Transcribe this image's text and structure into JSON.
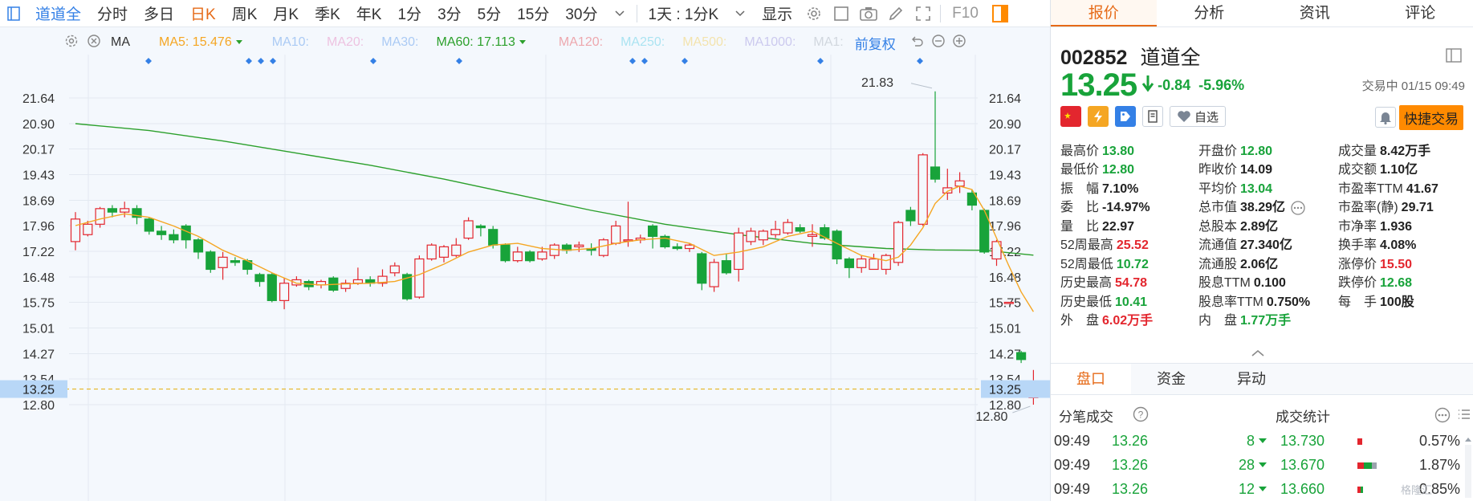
{
  "toolbar": {
    "items": [
      "道道全",
      "分时",
      "多日",
      "日K",
      "周K",
      "月K",
      "季K",
      "年K",
      "1分",
      "3分",
      "5分",
      "15分",
      "30分"
    ],
    "period_select": "1天 : 1分K",
    "display_label": "显示",
    "f10_label": "F10"
  },
  "ma_row": {
    "ma_label": "MA",
    "ma5": "MA5: 15.476",
    "ma10": "MA10:",
    "ma20": "MA20:",
    "ma30": "MA30:",
    "ma60": "MA60: 17.113",
    "ma120": "MA120:",
    "ma250": "MA250:",
    "ma500": "MA500:",
    "ma1000": "MA1000:",
    "ma1": "MA1:",
    "adjust_label": "前复权",
    "colors": {
      "ma5": "#f5a623",
      "ma10": "#3480e6",
      "ma20": "#e46bb3",
      "ma30": "#3480e6",
      "ma60": "#2ca02c",
      "ma120": "#e3262e",
      "ma250": "#35c3e0",
      "ma500": "#f2c32e",
      "ma1000": "#8b7fd8",
      "ma1": "#9aa3ad"
    }
  },
  "chart_data": {
    "type": "candlestick",
    "y_ticks": [
      "21.64",
      "20.90",
      "20.17",
      "19.43",
      "18.69",
      "17.96",
      "17.22",
      "16.48",
      "15.75",
      "15.01",
      "14.27",
      "13.54",
      "12.80"
    ],
    "ylim": [
      12.8,
      21.64
    ],
    "current_price": "13.25",
    "high_label": "21.83",
    "low_label": "12.80",
    "colors": {
      "up": "#e3262e",
      "down": "#18a33a",
      "ma5": "#f5a623",
      "ma60": "#2ca02c"
    },
    "candles": [
      [
        17.5,
        18.15,
        18.35,
        17.25
      ],
      [
        17.7,
        18.0,
        18.1,
        17.65
      ],
      [
        18.0,
        18.45,
        18.5,
        17.9
      ],
      [
        18.45,
        18.35,
        18.55,
        18.2
      ],
      [
        18.35,
        18.45,
        18.65,
        18.2
      ],
      [
        18.45,
        18.2,
        18.55,
        18.0
      ],
      [
        18.15,
        17.8,
        18.2,
        17.7
      ],
      [
        17.8,
        17.7,
        17.95,
        17.55
      ],
      [
        17.7,
        17.55,
        17.85,
        17.45
      ],
      [
        17.95,
        17.55,
        18.0,
        17.3
      ],
      [
        17.55,
        17.2,
        17.6,
        17.0
      ],
      [
        17.2,
        16.7,
        17.25,
        16.6
      ],
      [
        16.75,
        17.05,
        17.2,
        16.4
      ],
      [
        16.95,
        16.9,
        17.05,
        16.8
      ],
      [
        16.95,
        16.7,
        17.0,
        16.55
      ],
      [
        16.55,
        16.35,
        16.6,
        16.2
      ],
      [
        16.55,
        15.8,
        16.6,
        15.75
      ],
      [
        15.8,
        16.3,
        16.45,
        15.55
      ],
      [
        16.25,
        16.4,
        16.5,
        16.2
      ],
      [
        16.35,
        16.2,
        16.4,
        16.1
      ],
      [
        16.25,
        16.35,
        16.4,
        16.15
      ],
      [
        16.45,
        16.1,
        16.5,
        16.05
      ],
      [
        16.15,
        16.3,
        16.4,
        16.05
      ],
      [
        16.3,
        16.4,
        16.75,
        16.25
      ],
      [
        16.4,
        16.3,
        16.5,
        16.2
      ],
      [
        16.3,
        16.5,
        16.7,
        16.2
      ],
      [
        16.6,
        16.8,
        16.9,
        16.5
      ],
      [
        16.55,
        15.85,
        16.6,
        15.8
      ],
      [
        15.9,
        17.0,
        17.1,
        15.85
      ],
      [
        17.0,
        17.4,
        17.45,
        16.95
      ],
      [
        17.05,
        17.35,
        17.4,
        16.9
      ],
      [
        17.1,
        17.4,
        17.6,
        17.05
      ],
      [
        17.6,
        18.1,
        18.2,
        17.55
      ],
      [
        17.95,
        17.9,
        18.0,
        17.65
      ],
      [
        17.85,
        17.4,
        17.95,
        17.3
      ],
      [
        17.4,
        16.95,
        17.45,
        16.9
      ],
      [
        16.95,
        17.2,
        17.35,
        16.9
      ],
      [
        17.2,
        16.95,
        17.25,
        16.9
      ],
      [
        17.0,
        17.2,
        17.35,
        16.95
      ],
      [
        17.1,
        17.4,
        17.45,
        17.0
      ],
      [
        17.4,
        17.25,
        17.45,
        17.15
      ],
      [
        17.35,
        17.4,
        17.5,
        17.2
      ],
      [
        17.3,
        17.25,
        17.45,
        17.1
      ],
      [
        17.1,
        17.55,
        17.6,
        17.05
      ],
      [
        17.45,
        17.95,
        18.1,
        17.4
      ],
      [
        17.55,
        17.55,
        18.65,
        17.35
      ],
      [
        17.55,
        17.6,
        17.7,
        17.45
      ],
      [
        17.95,
        17.65,
        18.0,
        17.3
      ],
      [
        17.65,
        17.35,
        17.7,
        17.3
      ],
      [
        17.35,
        17.3,
        17.45,
        17.25
      ],
      [
        17.3,
        17.4,
        17.45,
        17.2
      ],
      [
        17.15,
        16.3,
        17.2,
        16.1
      ],
      [
        16.2,
        16.9,
        17.0,
        16.05
      ],
      [
        16.95,
        16.6,
        17.15,
        16.55
      ],
      [
        16.7,
        17.75,
        17.9,
        16.35
      ],
      [
        17.5,
        17.8,
        17.9,
        17.4
      ],
      [
        17.55,
        17.8,
        17.85,
        17.4
      ],
      [
        17.7,
        17.85,
        18.1,
        17.6
      ],
      [
        17.75,
        18.05,
        18.15,
        17.7
      ],
      [
        17.9,
        17.8,
        18.0,
        17.75
      ],
      [
        17.65,
        17.7,
        18.0,
        17.35
      ],
      [
        17.9,
        17.6,
        18.0,
        17.55
      ],
      [
        17.8,
        17.0,
        17.85,
        16.85
      ],
      [
        17.0,
        16.75,
        17.05,
        16.45
      ],
      [
        16.75,
        17.0,
        17.1,
        16.6
      ],
      [
        16.7,
        17.0,
        17.15,
        16.7
      ],
      [
        16.7,
        17.1,
        17.15,
        16.55
      ],
      [
        16.9,
        18.05,
        18.1,
        16.8
      ],
      [
        18.4,
        18.1,
        18.5,
        17.95
      ],
      [
        18.0,
        20.0,
        20.05,
        17.95
      ],
      [
        19.65,
        19.3,
        21.83,
        19.2
      ],
      [
        18.9,
        19.05,
        19.6,
        18.7
      ],
      [
        19.1,
        19.25,
        19.5,
        18.9
      ],
      [
        18.9,
        18.55,
        19.0,
        18.4
      ],
      [
        18.4,
        17.2,
        18.45,
        17.15
      ],
      [
        17.0,
        17.5,
        17.55,
        16.8
      ],
      [
        15.75,
        15.75,
        15.75,
        15.75
      ],
      [
        14.3,
        14.1,
        14.35,
        14.0
      ],
      [
        13.0,
        13.25,
        13.8,
        12.8
      ]
    ],
    "ma5": [
      [
        0,
        17.96
      ],
      [
        2,
        18.15
      ],
      [
        4,
        18.3
      ],
      [
        6,
        18.2
      ],
      [
        8,
        17.95
      ],
      [
        10,
        17.65
      ],
      [
        12,
        17.25
      ],
      [
        14,
        16.95
      ],
      [
        16,
        16.6
      ],
      [
        18,
        16.3
      ],
      [
        20,
        16.25
      ],
      [
        22,
        16.28
      ],
      [
        24,
        16.3
      ],
      [
        26,
        16.35
      ],
      [
        28,
        16.55
      ],
      [
        30,
        16.85
      ],
      [
        32,
        17.2
      ],
      [
        34,
        17.4
      ],
      [
        36,
        17.45
      ],
      [
        38,
        17.3
      ],
      [
        40,
        17.25
      ],
      [
        42,
        17.3
      ],
      [
        44,
        17.45
      ],
      [
        46,
        17.55
      ],
      [
        48,
        17.6
      ],
      [
        50,
        17.45
      ],
      [
        52,
        17.1
      ],
      [
        54,
        17.2
      ],
      [
        56,
        17.35
      ],
      [
        58,
        17.65
      ],
      [
        60,
        17.8
      ],
      [
        62,
        17.45
      ],
      [
        64,
        17.1
      ],
      [
        66,
        16.95
      ],
      [
        67,
        17.05
      ],
      [
        68,
        17.4
      ],
      [
        69,
        17.9
      ],
      [
        70,
        18.6
      ],
      [
        71,
        18.95
      ],
      [
        72,
        19.1
      ],
      [
        73,
        19.0
      ],
      [
        74,
        18.4
      ],
      [
        75,
        17.6
      ],
      [
        76,
        16.8
      ],
      [
        77,
        16.05
      ],
      [
        78,
        15.48
      ]
    ],
    "ma60": [
      [
        0,
        20.9
      ],
      [
        6,
        20.7
      ],
      [
        12,
        20.4
      ],
      [
        18,
        20.05
      ],
      [
        24,
        19.7
      ],
      [
        30,
        19.3
      ],
      [
        36,
        18.85
      ],
      [
        42,
        18.4
      ],
      [
        48,
        18.0
      ],
      [
        54,
        17.7
      ],
      [
        60,
        17.45
      ],
      [
        66,
        17.3
      ],
      [
        70,
        17.26
      ],
      [
        74,
        17.25
      ],
      [
        78,
        17.11
      ]
    ]
  },
  "quote": {
    "tabs": [
      "报价",
      "分析",
      "资讯",
      "评论"
    ],
    "code": "002852",
    "name": "道道全",
    "price": "13.25",
    "change": "-0.84",
    "change_pct": "-5.96%",
    "status": "交易中 01/15 09:49",
    "watch_label": "自选",
    "quick_trade": "快捷交易",
    "stats": [
      [
        {
          "label": "最高价",
          "value": "13.80",
          "color": "green"
        },
        {
          "label": "开盘价",
          "value": "12.80",
          "color": "green"
        },
        {
          "label": "成交量",
          "value": "8.42万手",
          "color": "black"
        }
      ],
      [
        {
          "label": "最低价",
          "value": "12.80",
          "color": "green"
        },
        {
          "label": "昨收价",
          "value": "14.09",
          "color": "black"
        },
        {
          "label": "成交额",
          "value": "1.10亿",
          "color": "black"
        }
      ],
      [
        {
          "label": "振　幅",
          "value": "7.10%",
          "color": "black"
        },
        {
          "label": "平均价",
          "value": "13.04",
          "color": "green"
        },
        {
          "label": "市盈率TTM",
          "value": "41.67",
          "color": "black"
        }
      ],
      [
        {
          "label": "委　比",
          "value": "-14.97%",
          "color": "black"
        },
        {
          "label": "总市值",
          "value": "38.29亿",
          "color": "black"
        },
        {
          "label": "市盈率(静)",
          "value": "29.71",
          "color": "black"
        }
      ],
      [
        {
          "label": "量　比",
          "value": "22.97",
          "color": "black"
        },
        {
          "label": "总股本",
          "value": "2.89亿",
          "color": "black"
        },
        {
          "label": "市净率",
          "value": "1.936",
          "color": "black"
        }
      ],
      [
        {
          "label": "52周最高",
          "value": "25.52",
          "color": "red"
        },
        {
          "label": "流通值",
          "value": "27.340亿",
          "color": "black"
        },
        {
          "label": "换手率",
          "value": "4.08%",
          "color": "black"
        }
      ],
      [
        {
          "label": "52周最低",
          "value": "10.72",
          "color": "green"
        },
        {
          "label": "流通股",
          "value": "2.06亿",
          "color": "black"
        },
        {
          "label": "涨停价",
          "value": "15.50",
          "color": "red"
        }
      ],
      [
        {
          "label": "历史最高",
          "value": "54.78",
          "color": "red"
        },
        {
          "label": "股息TTM",
          "value": "0.100",
          "color": "black"
        },
        {
          "label": "跌停价",
          "value": "12.68",
          "color": "green"
        }
      ],
      [
        {
          "label": "历史最低",
          "value": "10.41",
          "color": "green"
        },
        {
          "label": "股息率TTM",
          "value": "0.750%",
          "color": "black"
        },
        {
          "label": "每　手",
          "value": "100股",
          "color": "black"
        }
      ],
      [
        {
          "label": "外　盘",
          "value": "6.02万手",
          "color": "red"
        },
        {
          "label": "内　盘",
          "value": "1.77万手",
          "color": "green"
        },
        {
          "label": "",
          "value": "",
          "color": "black"
        }
      ]
    ],
    "subtabs": [
      "盘口",
      "资金",
      "异动"
    ],
    "trades_title": "分笔成交",
    "stats_title": "成交统计",
    "trades": [
      {
        "time": "09:49",
        "price": "13.26",
        "vol": "8",
        "stat_price": "13.730",
        "pct": "0.57%",
        "bar": [
          6,
          0,
          0
        ]
      },
      {
        "time": "09:49",
        "price": "13.26",
        "vol": "28",
        "stat_price": "13.670",
        "pct": "1.87%",
        "bar": [
          8,
          10,
          6
        ]
      },
      {
        "time": "09:49",
        "price": "13.26",
        "vol": "12",
        "stat_price": "13.660",
        "pct": "0.85%",
        "bar": [
          4,
          3,
          0
        ]
      }
    ],
    "watermark": "格隆汇"
  }
}
